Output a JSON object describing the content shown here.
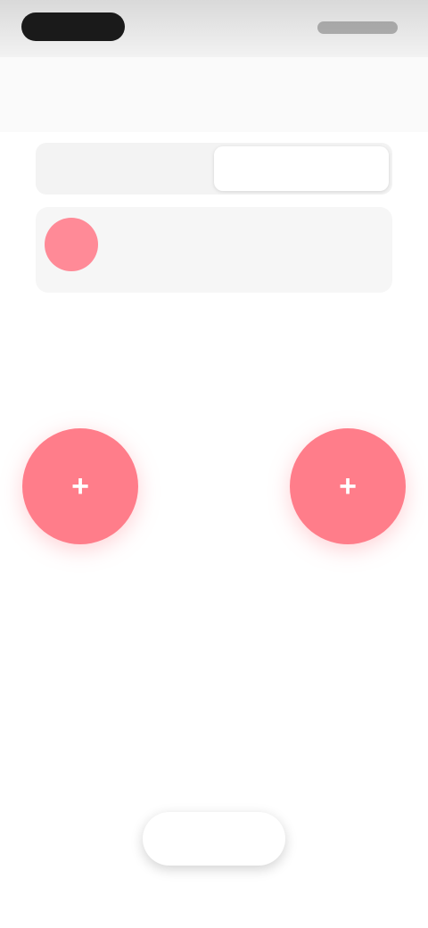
{
  "nav": {
    "title": "",
    "action": ""
  },
  "tabs": [
    {
      "label": ""
    },
    {
      "label": ""
    }
  ],
  "device": {
    "name": "",
    "subtitle": "",
    "detail": "",
    "right_text": ""
  },
  "actions": [
    {
      "top_label": "",
      "icon_glyph": "+",
      "bottom_label": ""
    },
    {
      "top_label": "",
      "icon_glyph": "+",
      "bottom_label": ""
    }
  ],
  "bottom_button": {
    "label": ""
  },
  "colors": {
    "accent": "#ff7d8a",
    "accent_text": "#ff5a6e"
  },
  "icons": {
    "status_left": "time-pill-icon",
    "status_right": "status-icons",
    "device": "device-avatar-icon",
    "action_left": "plus-icon",
    "action_right": "plus-icon"
  }
}
